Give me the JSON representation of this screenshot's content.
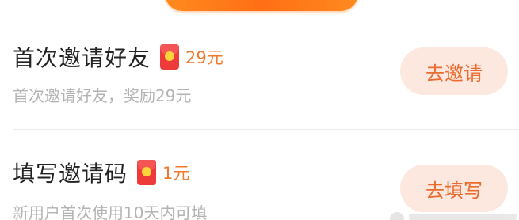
{
  "colors": {
    "accent_orange": "#f0792b",
    "button_bg": "#fde8df",
    "button_text": "#ea6b2f",
    "title_text": "#222222",
    "subtitle_text": "#b3b3b3",
    "divider": "#ececec",
    "red_packet": "#ef3a3a",
    "red_packet_seal": "#ffd43a",
    "top_tab": "#ff7a1a"
  },
  "tasks": [
    {
      "title": "首次邀请好友",
      "icon": "red-packet-icon",
      "reward": "29元",
      "subtitle": "首次邀请好友，奖励29元",
      "button_label": "去邀请"
    },
    {
      "title": "填写邀请码",
      "icon": "red-packet-icon",
      "reward": "1元",
      "subtitle": "新用户首次使用10天内可填",
      "button_label": "去填写"
    }
  ]
}
